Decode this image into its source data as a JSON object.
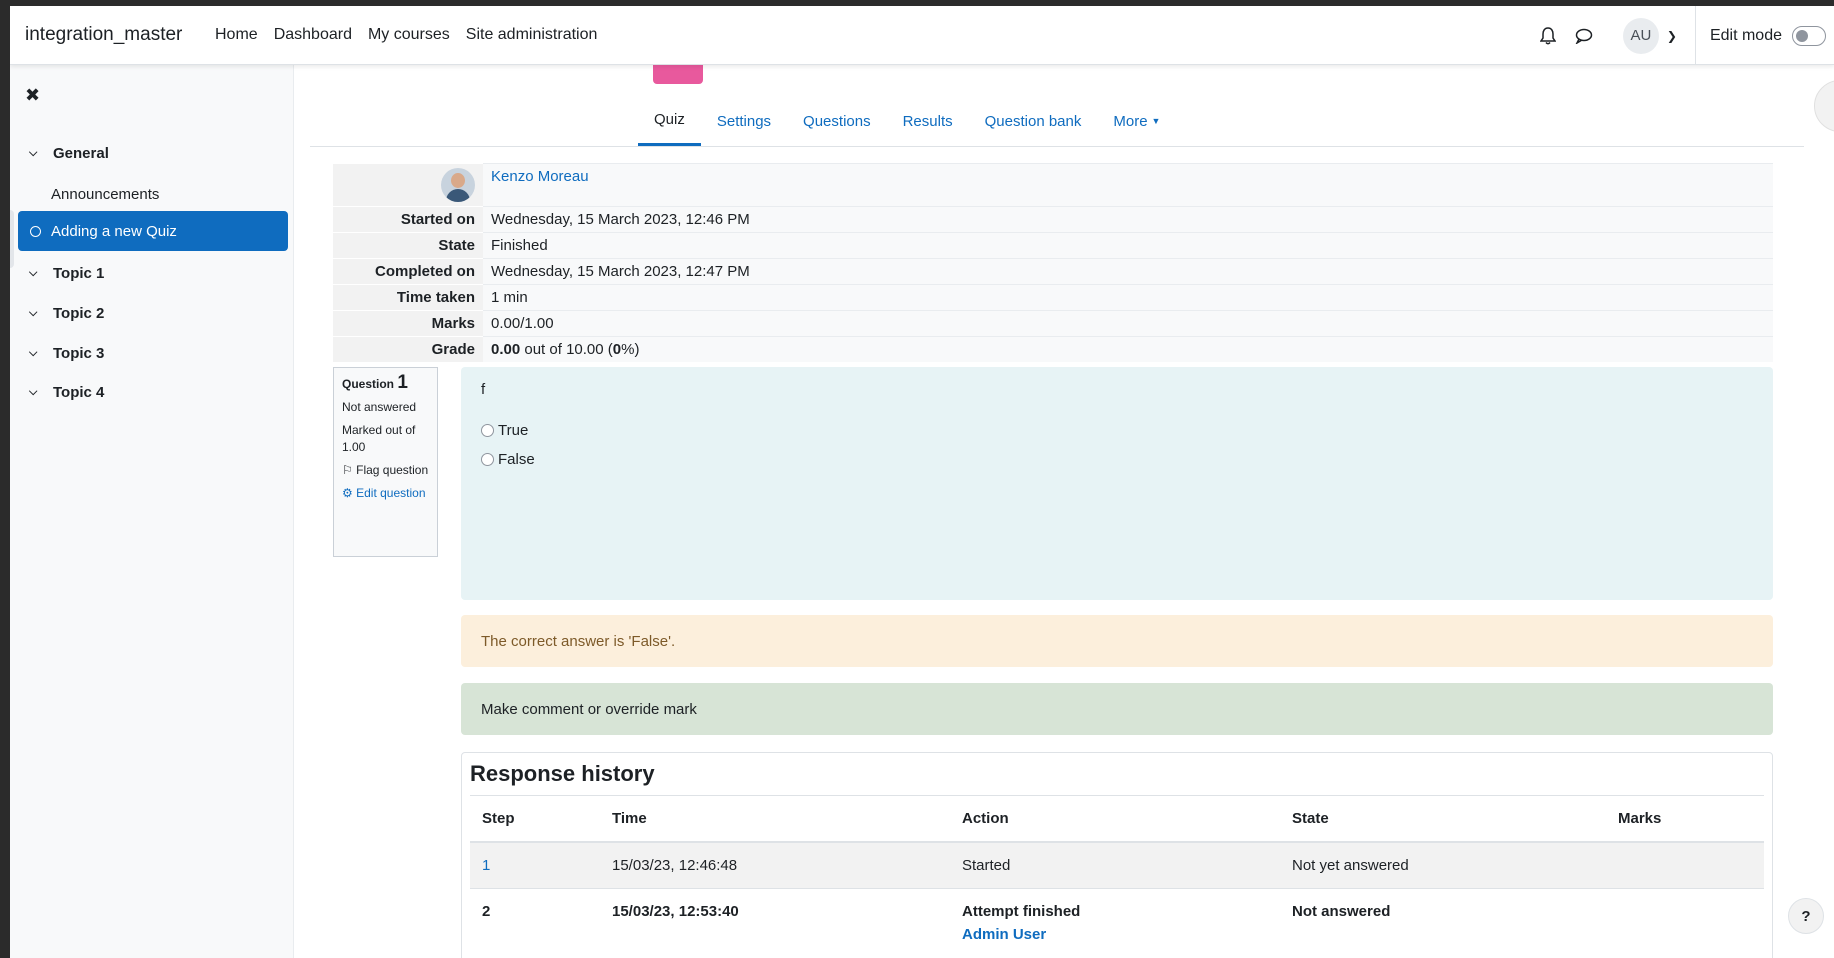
{
  "navbar": {
    "brand": "integration_master",
    "links": [
      "Home",
      "Dashboard",
      "My courses",
      "Site administration"
    ],
    "avatar_initials": "AU",
    "edit_mode_label": "Edit mode"
  },
  "drawer": {
    "sections": [
      {
        "label": "General"
      },
      {
        "label": "Topic 1"
      },
      {
        "label": "Topic 2"
      },
      {
        "label": "Topic 3"
      },
      {
        "label": "Topic 4"
      }
    ],
    "announcements": "Announcements",
    "active_item": "Adding a new Quiz"
  },
  "tabs": [
    "Quiz",
    "Settings",
    "Questions",
    "Results",
    "Question bank",
    "More"
  ],
  "summary": {
    "user_name": "Kenzo Moreau",
    "rows": [
      {
        "label": "Started on",
        "value": "Wednesday, 15 March 2023, 12:46 PM"
      },
      {
        "label": "State",
        "value": "Finished"
      },
      {
        "label": "Completed on",
        "value": "Wednesday, 15 March 2023, 12:47 PM"
      },
      {
        "label": "Time taken",
        "value": "1 min"
      },
      {
        "label": "Marks",
        "value": "0.00/1.00"
      }
    ],
    "grade_label": "Grade",
    "grade_value": "0.00",
    "grade_out_of": " out of 10.00 (",
    "grade_percent": "0",
    "grade_close": "%)"
  },
  "question": {
    "label": "Question",
    "number": "1",
    "status": "Not answered",
    "marked_out_of": "Marked out of 1.00",
    "flag": "Flag question",
    "edit": "Edit question",
    "text": "f",
    "options": [
      "True",
      "False"
    ],
    "feedback": "The correct answer is 'False'.",
    "comment": "Make comment or override mark"
  },
  "history": {
    "title": "Response history",
    "headers": [
      "Step",
      "Time",
      "Action",
      "State",
      "Marks"
    ],
    "rows": [
      {
        "step": "1",
        "time": "15/03/23, 12:46:48",
        "action": "Started",
        "user": "",
        "state": "Not yet answered",
        "marks": ""
      },
      {
        "step": "2",
        "time": "15/03/23, 12:53:40",
        "action": "Attempt finished",
        "user": "Admin User",
        "state": "Not answered",
        "marks": ""
      }
    ]
  },
  "help": "?",
  "colors": {
    "primary": "#0f6cbf",
    "quiz_icon": "#e8599d",
    "question_bg": "#e7f3f5",
    "feedback_bg": "#fcefdc",
    "comment_bg": "#d7e4d6"
  }
}
